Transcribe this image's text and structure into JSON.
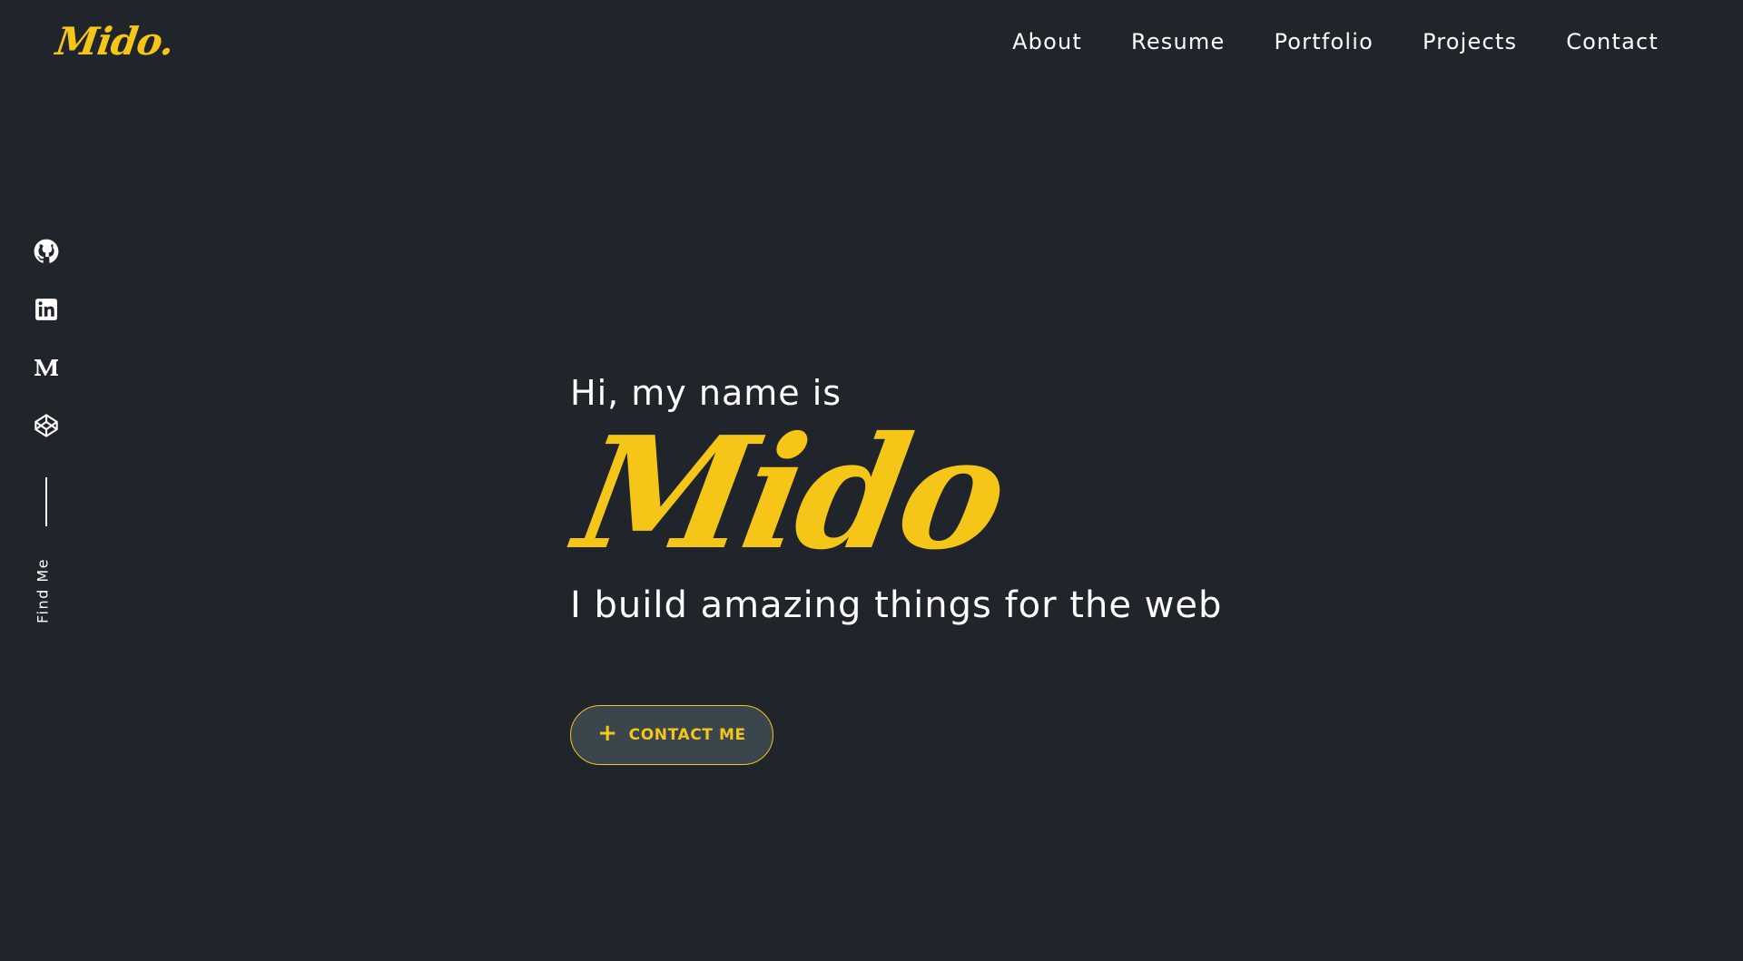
{
  "brand": {
    "logo_text": "Mido.",
    "accent_color": "#f5c518",
    "background_color": "#20242b"
  },
  "nav": {
    "items": [
      {
        "label": "About"
      },
      {
        "label": "Resume"
      },
      {
        "label": "Portfolio"
      },
      {
        "label": "Projects"
      },
      {
        "label": "Contact"
      }
    ]
  },
  "social": {
    "links": [
      {
        "icon": "github-icon"
      },
      {
        "icon": "linkedin-icon"
      },
      {
        "icon": "medium-icon"
      },
      {
        "icon": "codepen-icon"
      }
    ],
    "label": "Find Me"
  },
  "hero": {
    "greeting": "Hi, my name is",
    "name": "Mido",
    "tagline": "I build amazing things for the web",
    "cta_label": "CONTACT ME",
    "cta_icon": "plus-icon",
    "cta_background": "#3b454c"
  }
}
